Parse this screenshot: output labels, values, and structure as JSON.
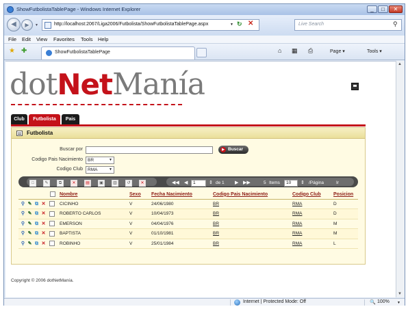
{
  "window": {
    "title": "ShowFutbolistaTablePage - Windows Internet Explorer",
    "min": "_",
    "max": "□",
    "close": "✕"
  },
  "navbar": {
    "back_icon": "◀",
    "forward_icon": "▶",
    "dropdown": "▼",
    "address": "http://localhost:2067/Liga2006/Futbolista/ShowFutbolistaTablePage.aspx",
    "refresh": "↻",
    "stop": "✕",
    "search_placeholder": "Live Search",
    "search_icon": "⚲"
  },
  "menubar": {
    "items": [
      "File",
      "Edit",
      "View",
      "Favorites",
      "Tools",
      "Help"
    ]
  },
  "favbar": {
    "star": "★",
    "add": "✚",
    "tab_label": "ShowFutbolistaTablePage",
    "commands": [
      "Page ▾",
      "Tools ▾"
    ],
    "home": "⌂",
    "feeds": "▦",
    "print": "⎙"
  },
  "app": {
    "logo_part1": "dot",
    "logo_part2": "Net",
    "logo_part3": "Manía",
    "tabs": [
      "Club",
      "Futbolista",
      "Pais"
    ],
    "panel_title": "Futbolista",
    "search_label": "Buscar por",
    "search_value": "",
    "search_button": "Buscar",
    "search_button_icon": "▶",
    "pais_label": "Codigo Pais Nacimiento",
    "pais_value": "BR",
    "club_label": "Codigo Club",
    "club_value": "RMA",
    "select_arrow": "▼",
    "toolbar_icons": [
      "□",
      "✎",
      "⧉",
      "✕",
      "▤",
      "▣",
      "▥",
      "↺",
      "✕"
    ],
    "pager": {
      "first": "◀◀",
      "prev": "◀",
      "page": "1",
      "spin": "⇕",
      "of_text": "de 1",
      "next": "▶",
      "last": "▶▶",
      "items_count": "5",
      "items_label": "Items",
      "page_size": "10",
      "per_page": "/Página",
      "go": "Ir"
    },
    "columns": [
      "",
      "Nombre",
      "Sexo",
      "Fecha Nacimiento",
      "Codigo Pais Nacimiento",
      "Codigo Club",
      "Posicion"
    ],
    "rows": [
      [
        "CICINHO",
        "V",
        "24/06/1980",
        "BR",
        "RMA",
        "D"
      ],
      [
        "ROBERTO CARLOS",
        "V",
        "10/04/1973",
        "BR",
        "RMA",
        "D"
      ],
      [
        "EMERSON",
        "V",
        "04/04/1976",
        "BR",
        "RMA",
        "M"
      ],
      [
        "BAPTISTA",
        "V",
        "01/10/1981",
        "BR",
        "RMA",
        "M"
      ],
      [
        "ROBINHO",
        "V",
        "25/01/1984",
        "BR",
        "RMA",
        "L"
      ]
    ],
    "copyright": "Copyright © 2006 dotNetManía."
  },
  "statusbar": {
    "zone": "Internet | Protected Mode: Off",
    "zoom": "100%",
    "zoom_icon": "🔍"
  }
}
